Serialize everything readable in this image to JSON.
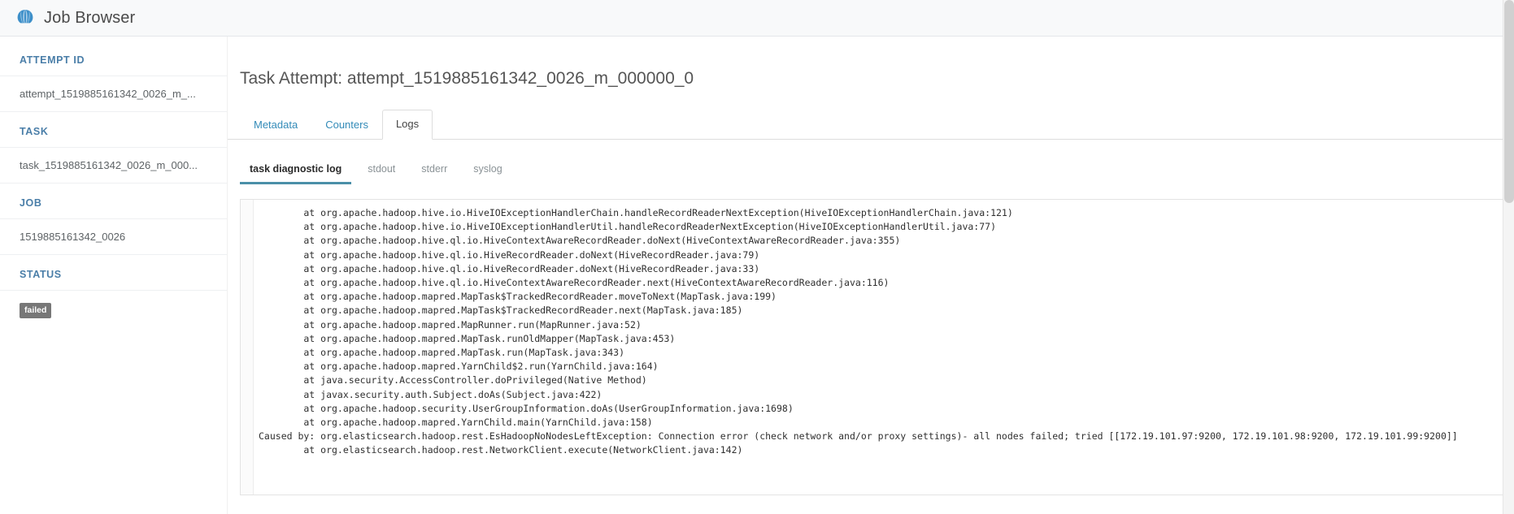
{
  "header": {
    "title": "Job Browser",
    "logo_icon": "hue-shell-logo-icon",
    "brand_color": "#2f8fd0"
  },
  "sidebar": {
    "sections": [
      {
        "label": "ATTEMPT ID",
        "value": "attempt_1519885161342_0026_m_..."
      },
      {
        "label": "TASK",
        "value": "task_1519885161342_0026_m_000..."
      },
      {
        "label": "JOB",
        "value": "1519885161342_0026"
      }
    ],
    "status": {
      "label": "STATUS",
      "badge": "failed",
      "badge_color": "#777777"
    }
  },
  "main": {
    "page_title": "Task Attempt: attempt_1519885161342_0026_m_000000_0",
    "tabs": [
      {
        "label": "Metadata",
        "active": false
      },
      {
        "label": "Counters",
        "active": false
      },
      {
        "label": "Logs",
        "active": true
      }
    ],
    "subtabs": [
      {
        "label": "task diagnostic log",
        "active": true
      },
      {
        "label": "stdout",
        "active": false
      },
      {
        "label": "stderr",
        "active": false
      },
      {
        "label": "syslog",
        "active": false
      }
    ],
    "log_text": "        at org.apache.hadoop.hive.io.HiveIOExceptionHandlerChain.handleRecordReaderNextException(HiveIOExceptionHandlerChain.java:121)\n        at org.apache.hadoop.hive.io.HiveIOExceptionHandlerUtil.handleRecordReaderNextException(HiveIOExceptionHandlerUtil.java:77)\n        at org.apache.hadoop.hive.ql.io.HiveContextAwareRecordReader.doNext(HiveContextAwareRecordReader.java:355)\n        at org.apache.hadoop.hive.ql.io.HiveRecordReader.doNext(HiveRecordReader.java:79)\n        at org.apache.hadoop.hive.ql.io.HiveRecordReader.doNext(HiveRecordReader.java:33)\n        at org.apache.hadoop.hive.ql.io.HiveContextAwareRecordReader.next(HiveContextAwareRecordReader.java:116)\n        at org.apache.hadoop.mapred.MapTask$TrackedRecordReader.moveToNext(MapTask.java:199)\n        at org.apache.hadoop.mapred.MapTask$TrackedRecordReader.next(MapTask.java:185)\n        at org.apache.hadoop.mapred.MapRunner.run(MapRunner.java:52)\n        at org.apache.hadoop.mapred.MapTask.runOldMapper(MapTask.java:453)\n        at org.apache.hadoop.mapred.MapTask.run(MapTask.java:343)\n        at org.apache.hadoop.mapred.YarnChild$2.run(YarnChild.java:164)\n        at java.security.AccessController.doPrivileged(Native Method)\n        at javax.security.auth.Subject.doAs(Subject.java:422)\n        at org.apache.hadoop.security.UserGroupInformation.doAs(UserGroupInformation.java:1698)\n        at org.apache.hadoop.mapred.YarnChild.main(YarnChild.java:158)\nCaused by: org.elasticsearch.hadoop.rest.EsHadoopNoNodesLeftException: Connection error (check network and/or proxy settings)- all nodes failed; tried [[172.19.101.97:9200, 172.19.101.98:9200, 172.19.101.99:9200]]\n        at org.elasticsearch.hadoop.rest.NetworkClient.execute(NetworkClient.java:142)"
  }
}
